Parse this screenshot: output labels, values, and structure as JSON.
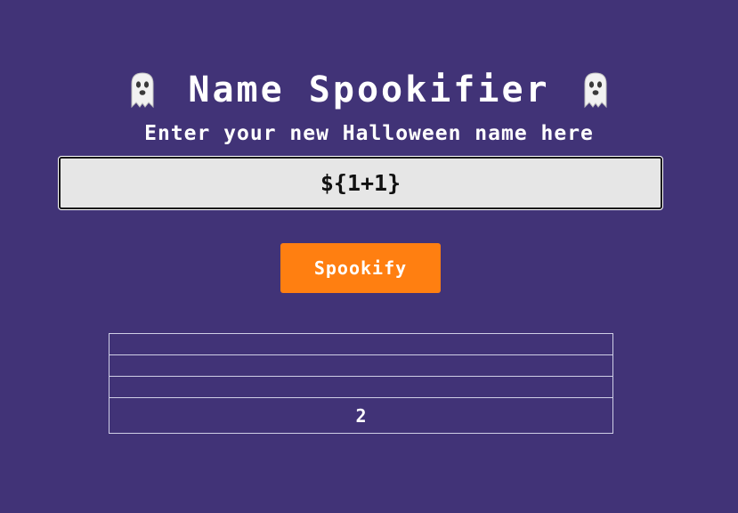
{
  "header": {
    "title": "Name Spookifier",
    "subtitle": "Enter your new Halloween name here",
    "left_icon": "ghost-icon",
    "right_icon": "ghost-icon"
  },
  "form": {
    "input_value": "${1+1}",
    "button_label": "Spookify"
  },
  "results": {
    "rows": [
      "",
      "",
      "",
      "2"
    ]
  },
  "colors": {
    "background": "#413377",
    "button": "#ff7f11",
    "input_background": "#e6e6e6",
    "text": "#ffffff"
  }
}
